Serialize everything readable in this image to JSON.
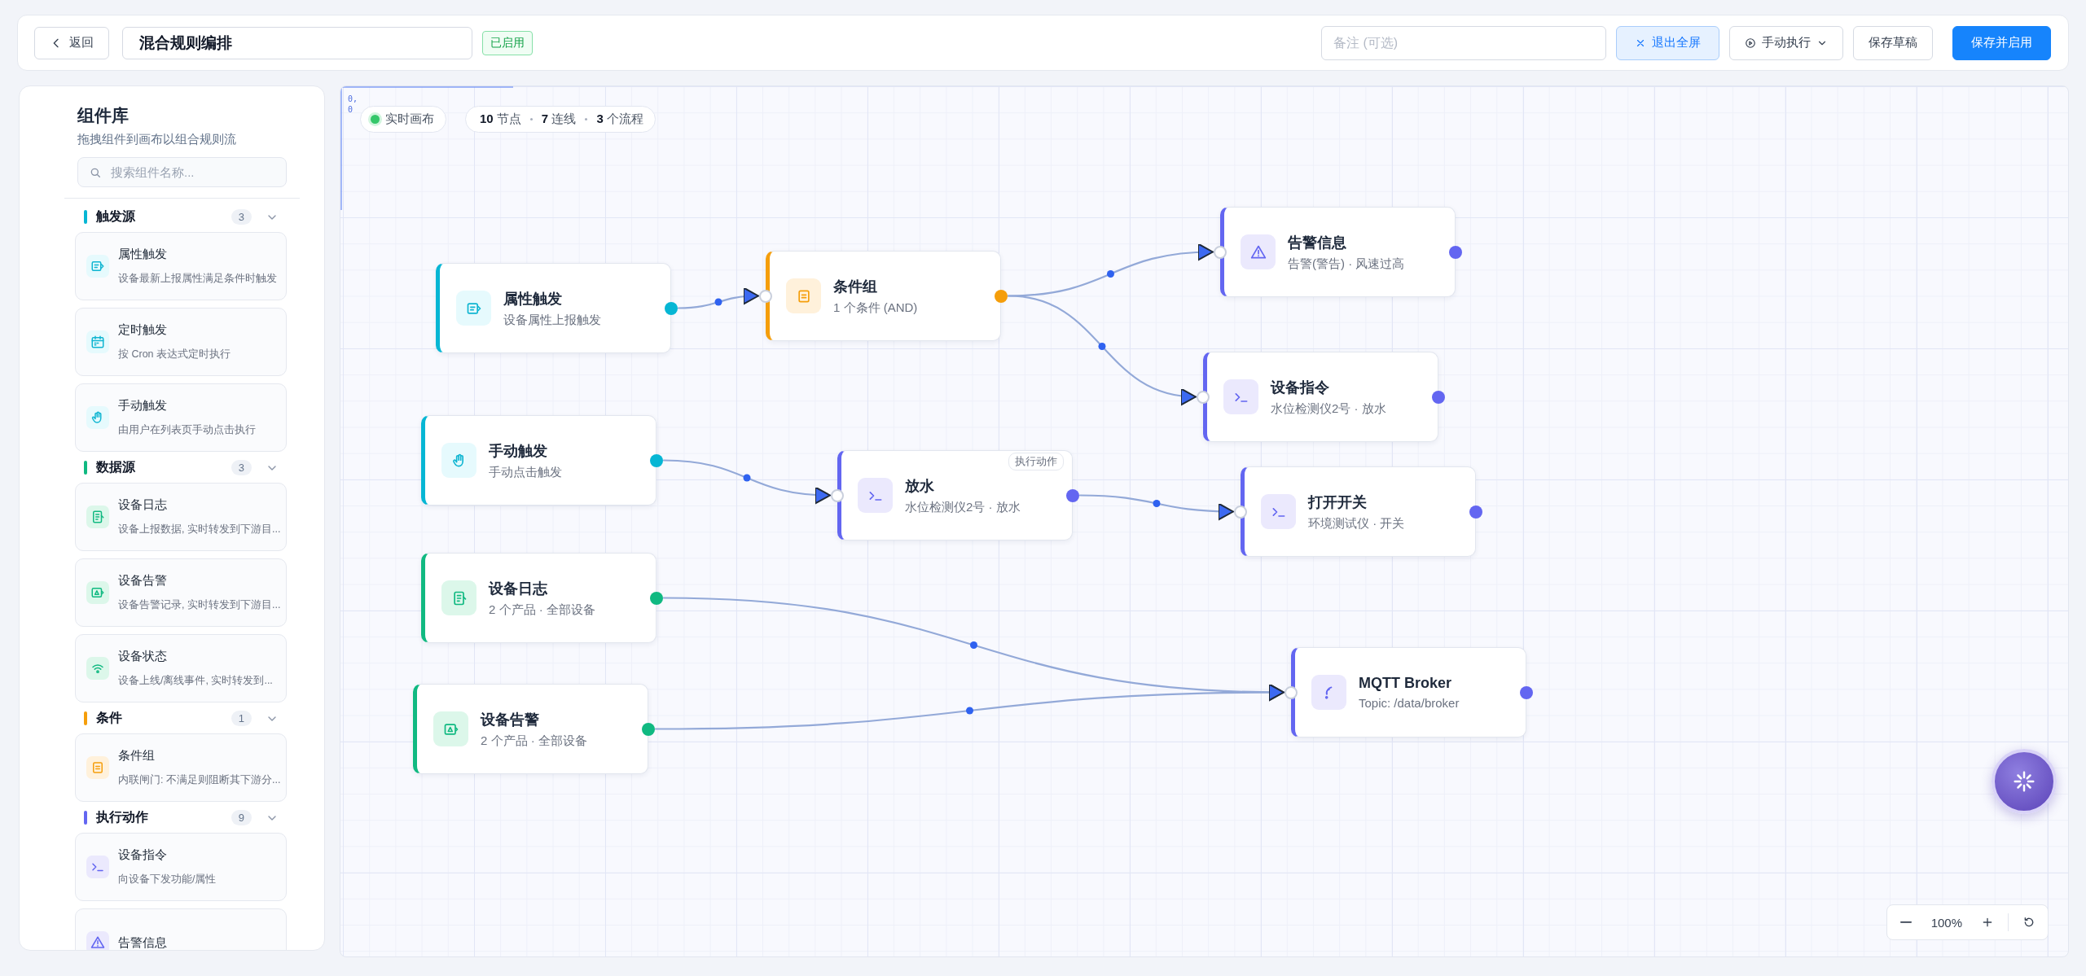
{
  "header": {
    "back": "返回",
    "title": "混合规则编排",
    "status": {
      "label": "已启用",
      "enabled": true
    },
    "remark": {
      "placeholder": "备注 (可选)"
    },
    "buttons": [
      {
        "label": "退出全屏",
        "kind": "toggle"
      },
      {
        "label": "手动执行",
        "kind": "dropdown"
      },
      {
        "label": "保存草稿",
        "kind": "default"
      },
      {
        "label": "保存并启用",
        "kind": "primary"
      }
    ]
  },
  "library": {
    "title": "组件库",
    "subtitle": "拖拽组件到画布以组合规则流",
    "search": {
      "placeholder": "搜索组件名称..."
    },
    "groups": [
      {
        "title": "触发源",
        "count": "3",
        "kind": "trigger",
        "expanded": true,
        "items": [
          {
            "name": "属性触发",
            "desc": "设备最新上报属性满足条件时触发"
          },
          {
            "name": "定时触发",
            "desc": "按 Cron 表达式定时执行"
          },
          {
            "name": "手动触发",
            "desc": "由用户在列表页手动点击执行"
          }
        ]
      },
      {
        "title": "数据源",
        "count": "3",
        "kind": "data",
        "expanded": true,
        "items": [
          {
            "name": "设备日志",
            "desc": "设备上报数据, 实时转发到下游目..."
          },
          {
            "name": "设备告警",
            "desc": "设备告警记录, 实时转发到下游目..."
          },
          {
            "name": "设备状态",
            "desc": "设备上线/离线事件, 实时转发到..."
          }
        ]
      },
      {
        "title": "条件",
        "count": "1",
        "kind": "condition",
        "expanded": true,
        "items": [
          {
            "name": "条件组",
            "desc": "内联闸门: 不满足则阻断其下游分..."
          }
        ]
      },
      {
        "title": "执行动作",
        "count": "9",
        "kind": "action",
        "expanded": true,
        "items": [
          {
            "name": "设备指令",
            "desc": "向设备下发功能/属性"
          },
          {
            "name": "告警信息"
          }
        ]
      }
    ]
  },
  "canvas": {
    "origin": "0, 0",
    "live": {
      "label": "实时画布",
      "on": true
    },
    "stats": [
      "**10** 节点",
      "**7** 连线",
      "**3** 个流程"
    ],
    "nodes": [
      {
        "kind": "trigger",
        "title": "属性触发",
        "subtitle": "设备属性上报触发"
      },
      {
        "kind": "condition",
        "title": "条件组",
        "subtitle": "1 个条件 (AND)"
      },
      {
        "kind": "action",
        "title": "告警信息",
        "subtitle": "告警(警告) · 风速过高"
      },
      {
        "kind": "action",
        "title": "设备指令",
        "subtitle": "水位检测仪2号 · 放水"
      },
      {
        "kind": "trigger",
        "title": "手动触发",
        "subtitle": "手动点击触发"
      },
      {
        "kind": "action",
        "title": "放水",
        "subtitle": "水位检测仪2号 · 放水",
        "tag": "执行动作"
      },
      {
        "kind": "action",
        "title": "打开开关",
        "subtitle": "环境测试仪 · 开关"
      },
      {
        "kind": "data",
        "title": "设备日志",
        "subtitle": "2 个产品 · 全部设备"
      },
      {
        "kind": "data",
        "title": "设备告警",
        "subtitle": "2 个产品 · 全部设备"
      },
      {
        "kind": "action",
        "title": "MQTT Broker",
        "subtitle": "Topic: /data/broker"
      }
    ],
    "zoom": "100%"
  }
}
